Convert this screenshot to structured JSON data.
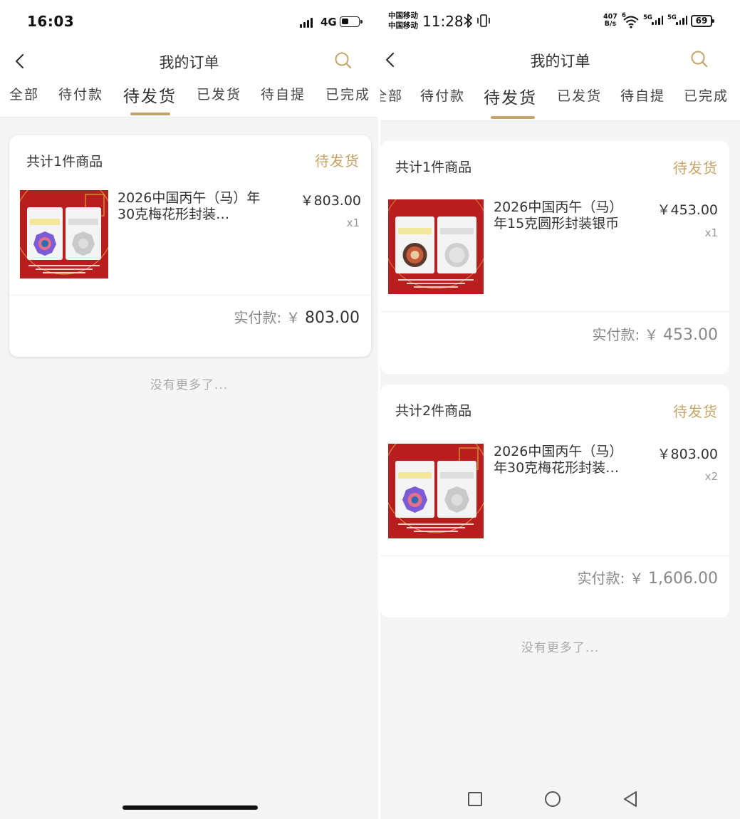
{
  "left": {
    "status": {
      "time": "16:03",
      "network": "4G",
      "battery_level": 0.45
    },
    "nav": {
      "title": "我的订单"
    },
    "tabs": [
      {
        "label": "全部",
        "active": false
      },
      {
        "label": "待付款",
        "active": false
      },
      {
        "label": "待发货",
        "active": true
      },
      {
        "label": "已发货",
        "active": false
      },
      {
        "label": "待自提",
        "active": false
      },
      {
        "label": "已完成",
        "active": false
      }
    ],
    "orders": [
      {
        "count_label": "共计1件商品",
        "status": "待发货",
        "item": {
          "name": "2026中国丙午（马）年30克梅花形封装…",
          "price": "￥803.00",
          "qty": "x1"
        },
        "total_label": "实付款: ",
        "total_currency": "￥ ",
        "total_amount": "803.00"
      }
    ],
    "no_more": "没有更多了..."
  },
  "right": {
    "status": {
      "carrier_1": "中国移动",
      "carrier_2": "中国移动",
      "time": "11:28",
      "speed_value": "407",
      "speed_unit": "B/s",
      "wifi_tag": "6",
      "sim1_tag": "5G",
      "sim2_tag": "5G",
      "battery": "69"
    },
    "nav": {
      "title": "我的订单"
    },
    "tabs": [
      {
        "label": "全部",
        "active": false
      },
      {
        "label": "待付款",
        "active": false
      },
      {
        "label": "待发货",
        "active": true
      },
      {
        "label": "已发货",
        "active": false
      },
      {
        "label": "待自提",
        "active": false
      },
      {
        "label": "已完成",
        "active": false
      }
    ],
    "orders": [
      {
        "count_label": "共计1件商品",
        "status": "待发货",
        "item": {
          "name": "2026中国丙午（马）年15克圆形封装银币",
          "price": "￥453.00",
          "qty": "x1"
        },
        "total_label": "实付款: ",
        "total_currency": "￥ ",
        "total_amount": "453.00"
      },
      {
        "count_label": "共计2件商品",
        "status": "待发货",
        "item": {
          "name": "2026中国丙午（马）年30克梅花形封装…",
          "price": "￥803.00",
          "qty": "x2"
        },
        "total_label": "实付款: ",
        "total_currency": "￥ ",
        "total_amount": "1,606.00"
      }
    ],
    "no_more": "没有更多了..."
  },
  "colors": {
    "accent": "#c4a468",
    "background": "#f5f5f5",
    "card": "#ffffff",
    "product_bg": "#b81e1e"
  },
  "icons": [
    "back-arrow",
    "search",
    "bluetooth",
    "vibrate",
    "wifi",
    "signal",
    "battery",
    "square",
    "circle",
    "triangle-back"
  ]
}
